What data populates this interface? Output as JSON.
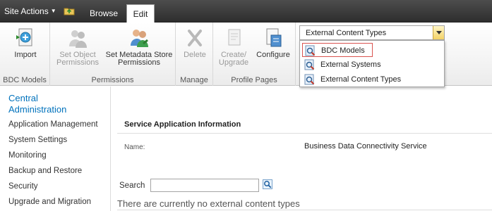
{
  "topbar": {
    "site_actions": "Site Actions",
    "tabs": [
      {
        "label": "Browse"
      },
      {
        "label": "Edit"
      }
    ]
  },
  "ribbon": {
    "groups": [
      {
        "label": "BDC Models",
        "buttons": [
          {
            "label": "Import",
            "enabled": true
          }
        ]
      },
      {
        "label": "Permissions",
        "buttons": [
          {
            "label": "Set Object Permissions",
            "line1": "Set Object",
            "line2": "Permissions",
            "enabled": false
          },
          {
            "label": "Set Metadata Store Permissions",
            "line1": "Set Metadata Store",
            "line2": "Permissions",
            "enabled": true
          }
        ]
      },
      {
        "label": "Manage",
        "buttons": [
          {
            "label": "Delete",
            "enabled": false
          }
        ]
      },
      {
        "label": "Profile Pages",
        "buttons": [
          {
            "label": "Create/ Upgrade",
            "line1": "Create/",
            "line2": "Upgrade",
            "enabled": false
          },
          {
            "label": "Configure",
            "enabled": true
          }
        ]
      }
    ],
    "view_select": {
      "value": "External Content Types",
      "options": [
        "BDC Models",
        "External Systems",
        "External Content Types"
      ]
    }
  },
  "leftnav": {
    "title_line1": "Central",
    "title_line2": "Administration",
    "items": [
      "Application Management",
      "System Settings",
      "Monitoring",
      "Backup and Restore",
      "Security",
      "Upgrade and Migration"
    ]
  },
  "main": {
    "section_title": "Service Application Information",
    "name_label": "Name:",
    "name_value": "Business Data Connectivity Service",
    "search_label": "Search",
    "search_value": "",
    "empty_message": "There are currently no external content types"
  },
  "colors": {
    "link": "#0072bc",
    "topbar": "#3a3a3a",
    "highlight_border": "#d9534f",
    "combo_button": "#f3d266"
  }
}
